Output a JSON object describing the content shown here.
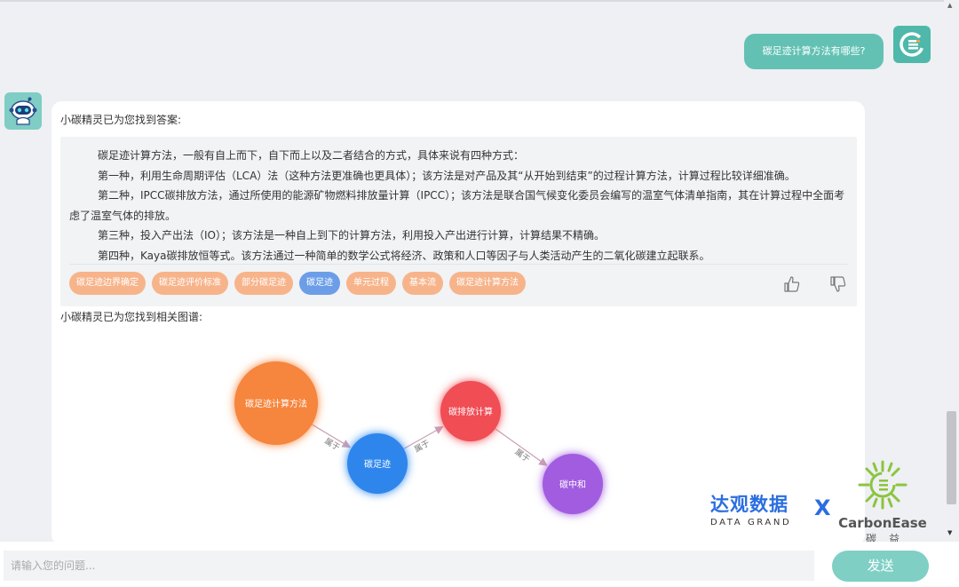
{
  "user_message": "碳足迹计算方法有哪些?",
  "answer": {
    "found_label": "小碳精灵已为您找到答案:",
    "paragraphs": [
      "碳足迹计算方法，一般有自上而下，自下而上以及二者结合的方式，具体来说有四种方式：",
      "第一种，利用生命周期评估（LCA）法（这种方法更准确也更具体）；该方法是对产品及其“从开始到结束”的过程计算方法，计算过程比较详细准确。",
      "第二种，IPCC碳排放方法，通过所使用的能源矿物燃料排放量计算（IPCC）；该方法是联合国气候变化委员会编写的温室气体清单指南，其在计算过程中全面考虑了温室气体的排放。",
      "第三种，投入产出法（IO）；该方法是一种自上到下的计算方法，利用投入产出进行计算，计算结果不精确。",
      "第四种，Kaya碳排放恒等式。该方法通过一种简单的数学公式将经济、政策和人口等因子与人类活动产生的二氧化碳建立起联系。"
    ],
    "tags": [
      "碳足迹边界确定",
      "碳足迹评价标准",
      "部分碳足迹",
      "碳足迹",
      "单元过程",
      "基本流",
      "碳足迹计算方法"
    ],
    "active_tag": 3
  },
  "graph": {
    "found_label": "小碳精灵已为您找到相关图谱:",
    "nodes": [
      {
        "id": "n1",
        "label": "碳足迹计算方法",
        "color": "#f6853e"
      },
      {
        "id": "n2",
        "label": "碳足迹",
        "color": "#2f86ec"
      },
      {
        "id": "n3",
        "label": "碳排放计算",
        "color": "#f04d55"
      },
      {
        "id": "n4",
        "label": "碳中和",
        "color": "#a25be0"
      }
    ],
    "edges": [
      {
        "from": "n1",
        "to": "n2",
        "label": "属于"
      },
      {
        "from": "n2",
        "to": "n3",
        "label": "属于"
      },
      {
        "from": "n3",
        "to": "n4",
        "label": "属于"
      }
    ]
  },
  "logos": {
    "datagrand_cn": "达观数据",
    "datagrand_en": "DATA GRAND",
    "cross": "X",
    "carbonease_name": "CarbonEase",
    "carbonease_cn": "碳益"
  },
  "input": {
    "placeholder": "请输入您的问题...",
    "value": ""
  },
  "send_label": "发送",
  "icons": {
    "user_avatar": "carbonease-logo-icon",
    "bot_avatar": "robot-icon",
    "like": "thumbs-up-icon",
    "dislike": "thumbs-down-icon"
  },
  "colors": {
    "accent": "#63c1b4",
    "tag": "#f7b48b",
    "tag_active": "#6c9ee8",
    "brand_blue": "#2b6ee0"
  }
}
